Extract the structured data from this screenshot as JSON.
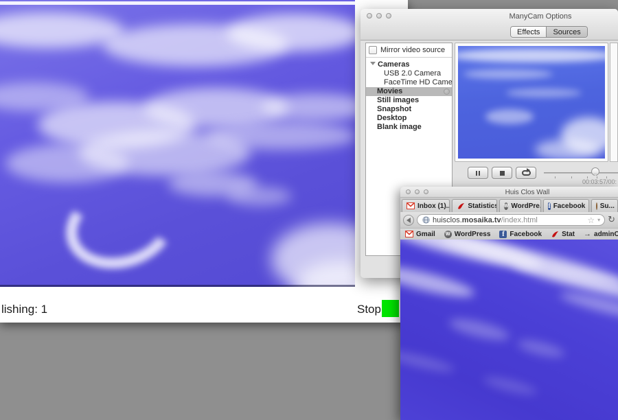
{
  "colors": {
    "desktop_gray": "#8f8f8f",
    "indicator_green": "#00e400",
    "facebook_blue": "#3b5998",
    "gmail_red": "#d93d2a",
    "stat_red": "#c41212",
    "video_blue": "#5a50d8"
  },
  "publisher": {
    "status_text": "lishing: 1",
    "stop_label": "Stop"
  },
  "manycam": {
    "window_title": "ManyCam Options",
    "tab_effects": "Effects",
    "tab_sources": "Sources",
    "mirror_label": "Mirror video source",
    "tree": {
      "group_cameras": "Cameras",
      "camera_usb": "USB 2.0 Camera",
      "camera_facetime": "FaceTime HD Camera...",
      "movies": "Movies",
      "still_images": "Still images",
      "snapshot": "Snapshot",
      "desktop": "Desktop",
      "blank_image": "Blank image"
    },
    "timecode": "00:03:57/00:"
  },
  "browser": {
    "window_title": "Huis Clos Wall",
    "tabs": {
      "t1": "Inbox (1)...",
      "t2": "Statistics...",
      "t3": "WordPre...",
      "t4": "Facebook",
      "t5": "Su..."
    },
    "url_prefix": "huisclos.",
    "url_domain": "mosaika.tv",
    "url_path": "/index.html",
    "star_glyph": "☆",
    "caret_glyph": "▾",
    "reload_glyph": "↻",
    "bookmarks": {
      "b1": "Gmail",
      "b2": "WordPress",
      "b3": "Facebook",
      "b4": "Stat",
      "b5": "adminOVH.html"
    },
    "wp_letter": "W",
    "fb_letter": "f",
    "arrow_glyph": "→"
  }
}
